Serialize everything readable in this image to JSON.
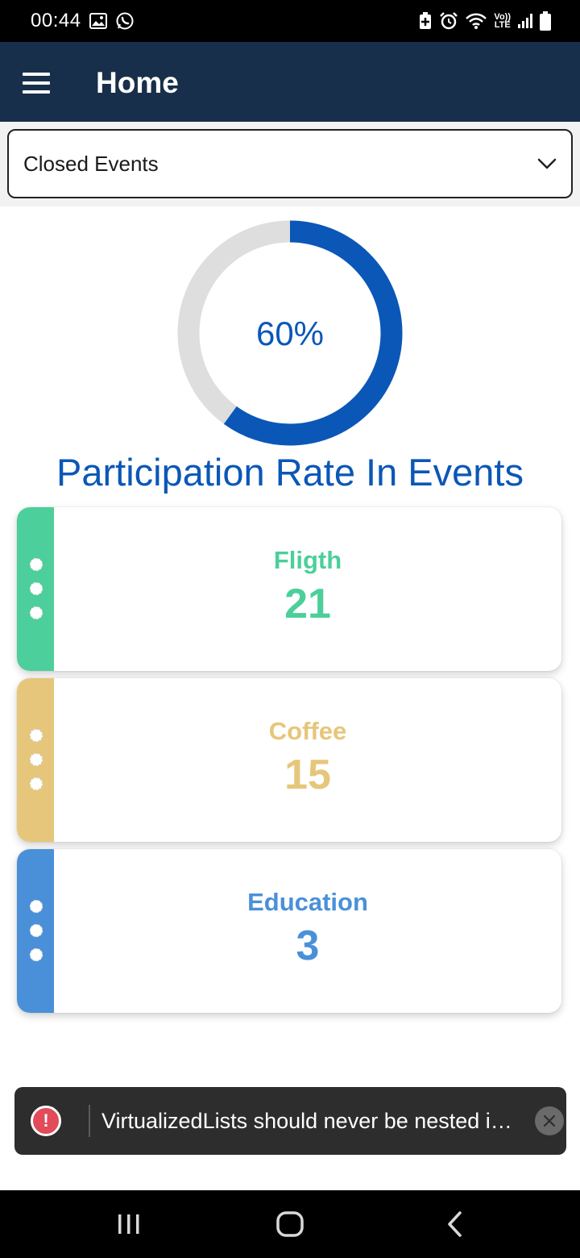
{
  "status_bar": {
    "time": "00:44",
    "lte_top": "Vo))",
    "lte_bottom": "LTE",
    "icons": [
      "gallery-icon",
      "whatsapp-icon",
      "battery-saver-icon",
      "alarm-icon",
      "wifi-icon",
      "signal-icon",
      "battery-icon"
    ]
  },
  "app_bar": {
    "title": "Home",
    "menu_icon": "hamburger-menu-icon"
  },
  "filter": {
    "selected": "Closed Events",
    "chevron_icon": "chevron-down-icon"
  },
  "participation": {
    "percent": 60,
    "percent_label": "60%",
    "title": "Participation Rate In Events",
    "progress_color": "#0b57b7",
    "track_color": "#dedede"
  },
  "categories": [
    {
      "name": "Fligth",
      "count": "21",
      "color": "#4ccf9a"
    },
    {
      "name": "Coffee",
      "count": "15",
      "color": "#e6c67a"
    },
    {
      "name": "Education",
      "count": "3",
      "color": "#4a90d9"
    }
  ],
  "toast": {
    "message": "VirtualizedLists should never be nested in…",
    "icon": "error-icon",
    "close_icon": "close-icon"
  },
  "nav_bar": {
    "icons": [
      "recent-apps-icon",
      "home-icon",
      "back-icon"
    ]
  }
}
